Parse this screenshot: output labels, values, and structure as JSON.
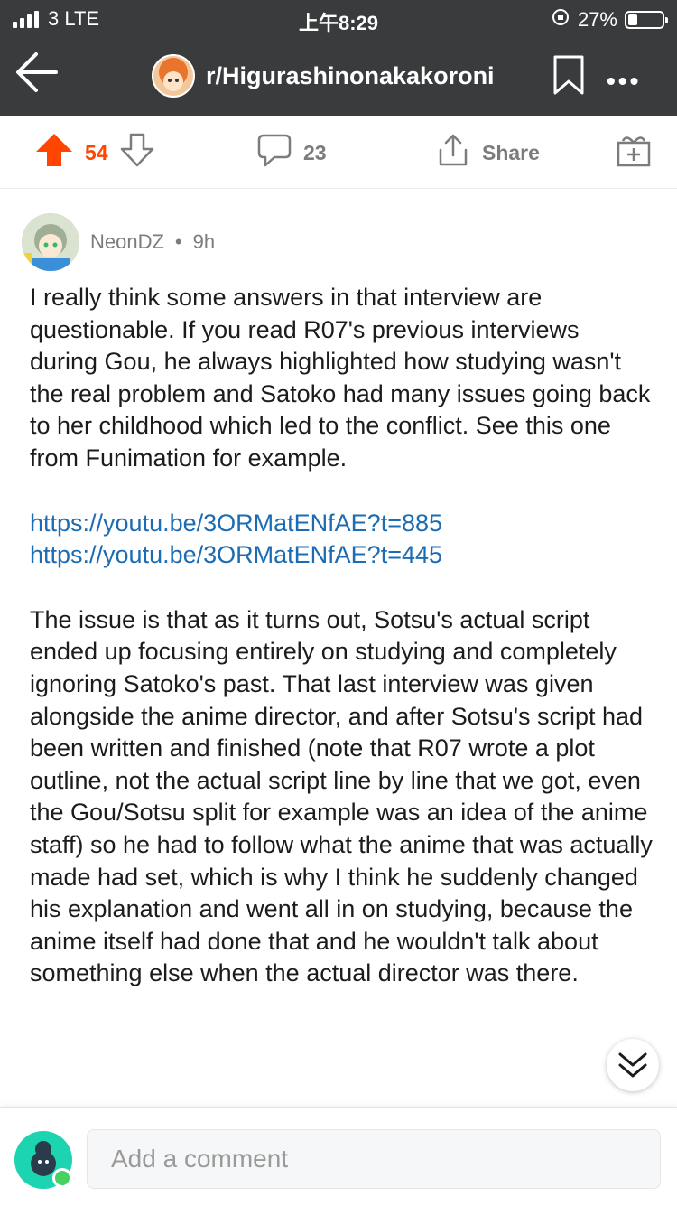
{
  "status_bar": {
    "carrier": "3  LTE",
    "time": "上午8:29",
    "battery": "27%"
  },
  "header": {
    "subreddit": "r/Higurashinonakakoroni"
  },
  "actions": {
    "upvotes": "54",
    "comments": "23",
    "share_label": "Share"
  },
  "comment": {
    "author": "NeonDZ",
    "separator": "•",
    "age": "9h",
    "paragraph1": "I really think some answers in that interview are questionable. If you read R07's previous interviews during Gou, he always highlighted how studying wasn't the real problem and Satoko had many issues going back to her childhood which led to the conflict. See this one from Funimation for example.",
    "links": "https://youtu.be/3ORMatENfAE?t=885 https://youtu.be/3ORMatENfAE?t=445",
    "paragraph2": "The issue is that as it turns out, Sotsu's actual script ended up focusing entirely on studying and completely ignoring Satoko's past. That last interview was given alongside the anime director, and after Sotsu's script had been written and finished (note that R07 wrote a plot outline, not the actual script line by line that we got, even the Gou/Sotsu split for example was an idea of the anime staff) so he had to follow what the anime that was actually made had set, which is why I think he suddenly changed his explanation and went all in on studying, because the anime itself had done that and he wouldn't talk about something else when the actual director was there."
  },
  "composer": {
    "placeholder": "Add a comment"
  },
  "colors": {
    "upvote": "#ff4500",
    "link": "#1c6cb3",
    "header_bg": "#3a3b3c"
  }
}
